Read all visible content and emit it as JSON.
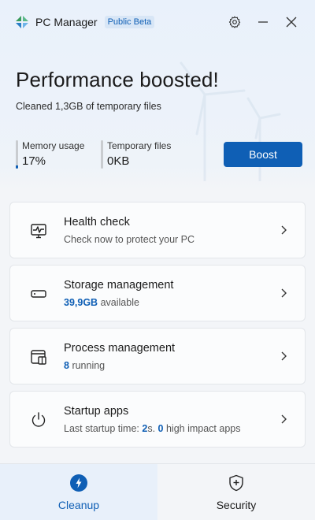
{
  "app": {
    "title": "PC Manager",
    "badge": "Public Beta",
    "accent_color": "#0f5fb5"
  },
  "titlebar": {
    "settings_icon": "gear-icon",
    "minimize_icon": "minimize-icon",
    "close_icon": "close-icon"
  },
  "hero": {
    "title": "Performance boosted!",
    "subtitle": "Cleaned 1,3GB of temporary files"
  },
  "stats": {
    "memory": {
      "label": "Memory usage",
      "value": "17%",
      "fill_percent": 17
    },
    "temp": {
      "label": "Temporary files",
      "value": "0KB",
      "fill_percent": 0
    }
  },
  "boost_button": {
    "label": "Boost"
  },
  "cards": [
    {
      "icon": "health-monitor-icon",
      "title": "Health check",
      "sub_text": "Check now to protect your PC"
    },
    {
      "icon": "storage-drive-icon",
      "title": "Storage management",
      "highlight": "39,9GB",
      "sub_text": "available"
    },
    {
      "icon": "process-window-icon",
      "title": "Process management",
      "highlight": "8",
      "sub_text": "running"
    },
    {
      "icon": "power-icon",
      "title": "Startup apps",
      "sub_prefix": "Last startup time:",
      "startup_time": "2",
      "sub_mid": "s.",
      "high_impact": "0",
      "sub_suffix": "high impact apps"
    }
  ],
  "nav": {
    "tabs": [
      {
        "label": "Cleanup",
        "icon": "cleanup-bolt-icon",
        "active": true
      },
      {
        "label": "Security",
        "icon": "shield-plus-icon",
        "active": false
      }
    ]
  }
}
